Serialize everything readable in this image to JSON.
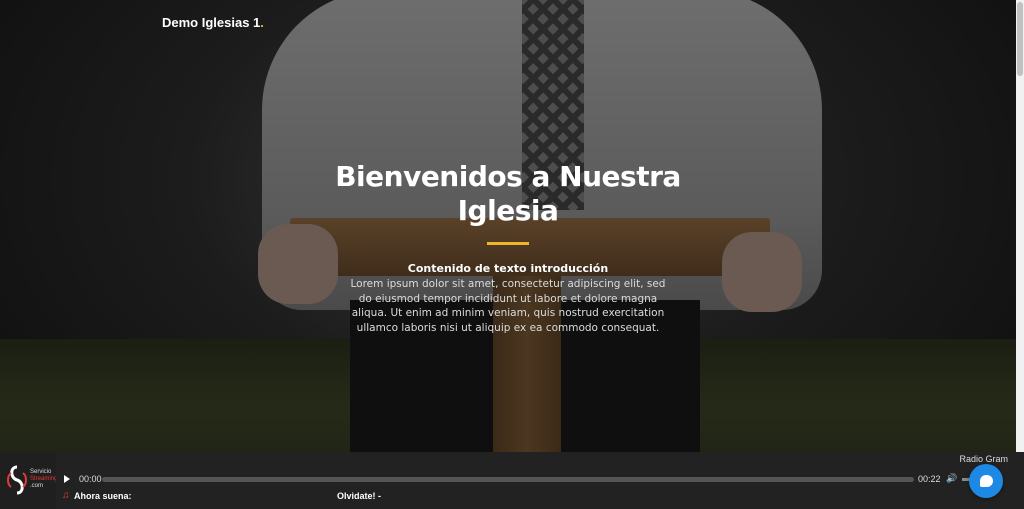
{
  "site": {
    "brand": "Demo Iglesias 1",
    "brand_dot": "."
  },
  "hero": {
    "title": "Bienvenidos a Nuestra Iglesia",
    "intro_heading": "Contenido de texto introducción",
    "intro_body": "Lorem ipsum dolor sit amet, consectetur adipiscing elit, sed do eiusmod tempor incididunt ut labore et dolore magna aliqua. Ut enim ad minim veniam, quis nostrud exercitation ullamco laboris nisi ut aliquip ex ea commodo consequat."
  },
  "player": {
    "logo_text_line1": "Servicio",
    "logo_text_line2": "Streaming",
    "logo_text_line3": ".com",
    "station": "Radio Gram",
    "current_time": "00:00",
    "duration": "00:22",
    "progress_fraction": 0,
    "now_playing_label": "Ahora suena:",
    "now_playing_title": "Olvidate! -",
    "icons": {
      "play": "play-icon",
      "volume": "volume-icon",
      "note": "music-note-icon"
    }
  },
  "chat": {
    "icon": "chat-bubble-icon"
  },
  "colors": {
    "accent": "#f0b429",
    "chat": "#1e88e5",
    "player_bg": "#222222"
  }
}
